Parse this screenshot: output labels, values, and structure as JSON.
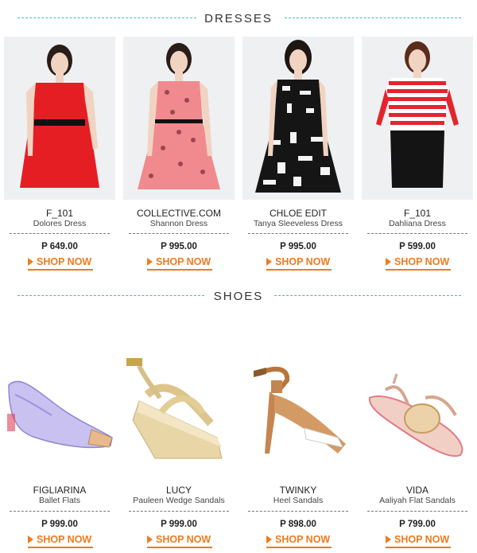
{
  "sections": [
    {
      "title": "DRESSES",
      "items": [
        {
          "brand": "F_101",
          "name": "Dolores Dress",
          "price": "P 649.00",
          "cta": "SHOP NOW"
        },
        {
          "brand": "COLLECTIVE.COM",
          "name": "Shannon Dress",
          "price": "P 995.00",
          "cta": "SHOP NOW"
        },
        {
          "brand": "CHLOE EDIT",
          "name": "Tanya Sleeveless Dress",
          "price": "P 995.00",
          "cta": "SHOP NOW"
        },
        {
          "brand": "F_101",
          "name": "Dahliana  Dress",
          "price": "P 599.00",
          "cta": "SHOP NOW"
        }
      ]
    },
    {
      "title": "SHOES",
      "items": [
        {
          "brand": "FIGLIARINA",
          "name": "Ballet Flats",
          "price": "P 999.00",
          "cta": "SHOP NOW"
        },
        {
          "brand": "LUCY",
          "name": "Pauleen Wedge Sandals",
          "price": "P 999.00",
          "cta": "SHOP NOW"
        },
        {
          "brand": "TWINKY",
          "name": "Heel Sandals",
          "price": "P 898.00",
          "cta": "SHOP NOW"
        },
        {
          "brand": "VIDA",
          "name": "Aaliyah Flat Sandals",
          "price": "P 799.00",
          "cta": "SHOP NOW"
        }
      ]
    }
  ],
  "colors": {
    "accent": "#f07a1e",
    "divider_teal": "#4bb9a8"
  },
  "icons": {
    "cta": "arrow-right-icon"
  }
}
